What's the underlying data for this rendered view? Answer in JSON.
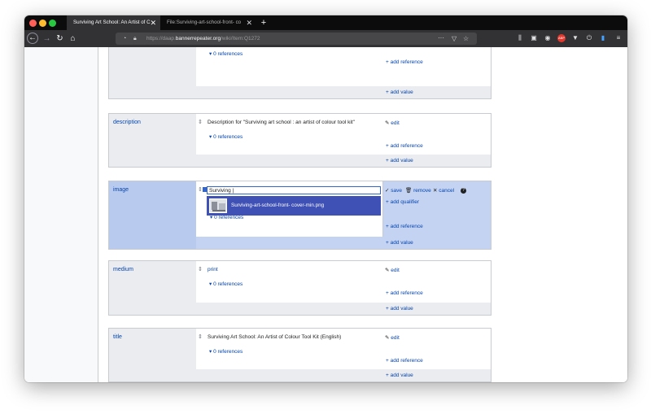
{
  "browser": {
    "tabs": [
      {
        "title": "Surviving Art School: An Artist of C",
        "close": "✕"
      },
      {
        "title": "File:Surviving-art-school-front- co",
        "close": "✕"
      }
    ],
    "new_tab": "+",
    "url_scheme": "https://daap.",
    "url_domain": "bannerrepeater.org",
    "url_path": "/wiki/Item:Q1272",
    "page_actions": "···"
  },
  "statements": [
    {
      "property": "",
      "value": "",
      "references": "0 references",
      "add_reference": "add reference",
      "add_value": "add value"
    },
    {
      "property": "description",
      "value": "Description for \"Surviving art school : an artist of colour tool kit\"",
      "edit": "edit",
      "references": "0 references",
      "add_reference": "add reference",
      "add_value": "add value"
    },
    {
      "property": "image",
      "input_value": "Surviving |",
      "save": "save",
      "remove": "remove",
      "cancel": "cancel",
      "help": "?",
      "add_qualifier": "add qualifier",
      "suggestion": "Surviving-art-school-front- cover-min.png",
      "references": "0 references",
      "add_reference": "add reference",
      "add_value": "add value"
    },
    {
      "property": "medium",
      "value": "print",
      "edit": "edit",
      "references": "0 references",
      "add_reference": "add reference",
      "add_value": "add value"
    },
    {
      "property": "title",
      "value": "Surviving Art School: An Artist of Colour Tool Kit (English)",
      "edit": "edit",
      "references": "0 references",
      "add_reference": "add reference",
      "add_value": "add value"
    }
  ],
  "colors": {
    "link": "#0645ad",
    "editing_bg": "#c4d3f2",
    "suggestion_bg": "#3f51b5",
    "browser_chrome": "#323234"
  }
}
